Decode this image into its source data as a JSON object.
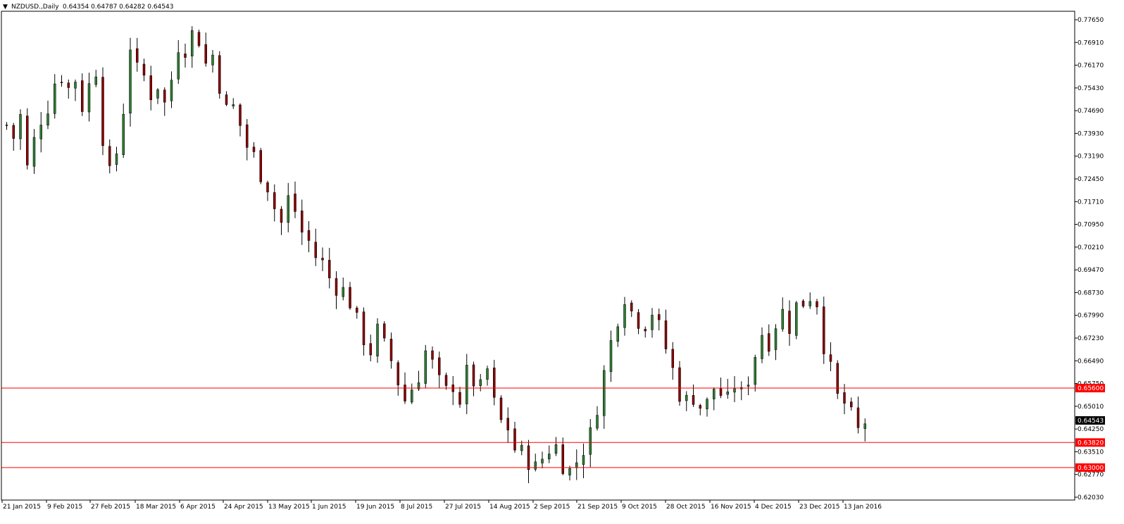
{
  "header": {
    "dropdown_glyph": "▼",
    "symbol": "NZDUSD.,Daily",
    "ohlc": "0.64354 0.64787 0.64282 0.64543"
  },
  "colors": {
    "background": "#ffffff",
    "axis": "#000000",
    "bull": "#2e7d32",
    "bear": "#8b0000",
    "hline": "#ff0000",
    "current_tag": "#000000"
  },
  "chart_data": {
    "type": "candlestick",
    "title": "NZDUSD.,Daily",
    "ylim": [
      0.6203,
      0.7765
    ],
    "y_ticks": [
      "0.77650",
      "0.76910",
      "0.76170",
      "0.75430",
      "0.74690",
      "0.73930",
      "0.73190",
      "0.72450",
      "0.71710",
      "0.70950",
      "0.70210",
      "0.69470",
      "0.68730",
      "0.67990",
      "0.67230",
      "0.66490",
      "0.65750",
      "0.65010",
      "0.64250",
      "0.63510",
      "0.62770",
      "0.62030"
    ],
    "x_labels": [
      "21 Jan 2015",
      "9 Feb 2015",
      "27 Feb 2015",
      "18 Mar 2015",
      "6 Apr 2015",
      "24 Apr 2015",
      "13 May 2015",
      "1 Jun 2015",
      "19 Jun 2015",
      "8 Jul 2015",
      "27 Jul 2015",
      "14 Aug 2015",
      "2 Sep 2015",
      "21 Sep 2015",
      "9 Oct 2015",
      "28 Oct 2015",
      "16 Nov 2015",
      "4 Dec 2015",
      "23 Dec 2015",
      "13 Jan 2016"
    ],
    "horizontal_lines": [
      {
        "value": 0.656,
        "label": "0.65600"
      },
      {
        "value": 0.6382,
        "label": "0.63820"
      },
      {
        "value": 0.63,
        "label": "0.63000"
      }
    ],
    "current_price": {
      "value": 0.64543,
      "label": "0.64543"
    },
    "price_path": [
      0.742,
      0.738,
      0.745,
      0.728,
      0.737,
      0.744,
      0.748,
      0.756,
      0.758,
      0.754,
      0.757,
      0.748,
      0.755,
      0.76,
      0.738,
      0.726,
      0.733,
      0.747,
      0.768,
      0.76,
      0.758,
      0.752,
      0.755,
      0.749,
      0.757,
      0.768,
      0.767,
      0.772,
      0.77,
      0.762,
      0.765,
      0.755,
      0.747,
      0.748,
      0.742,
      0.735,
      0.732,
      0.726,
      0.722,
      0.715,
      0.71,
      0.718,
      0.714,
      0.707,
      0.704,
      0.699,
      0.697,
      0.692,
      0.689,
      0.688,
      0.684,
      0.678,
      0.672,
      0.668,
      0.675,
      0.67,
      0.665,
      0.658,
      0.652,
      0.656,
      0.66,
      0.668,
      0.664,
      0.658,
      0.655,
      0.657,
      0.652,
      0.661,
      0.658,
      0.656,
      0.662,
      0.651,
      0.645,
      0.643,
      0.636,
      0.635,
      0.632,
      0.63,
      0.633,
      0.636,
      0.637,
      0.631,
      0.629,
      0.632,
      0.636,
      0.641,
      0.65,
      0.661,
      0.671,
      0.679,
      0.686,
      0.681,
      0.678,
      0.677,
      0.681,
      0.676,
      0.669,
      0.662,
      0.654,
      0.652,
      0.653,
      0.65,
      0.651,
      0.656,
      0.654,
      0.652,
      0.657,
      0.654,
      0.659,
      0.667,
      0.674,
      0.671,
      0.677,
      0.681,
      0.676,
      0.683,
      0.684,
      0.686,
      0.684,
      0.67,
      0.662,
      0.653,
      0.651,
      0.647,
      0.642,
      0.645
    ],
    "price_path_count": 126
  }
}
